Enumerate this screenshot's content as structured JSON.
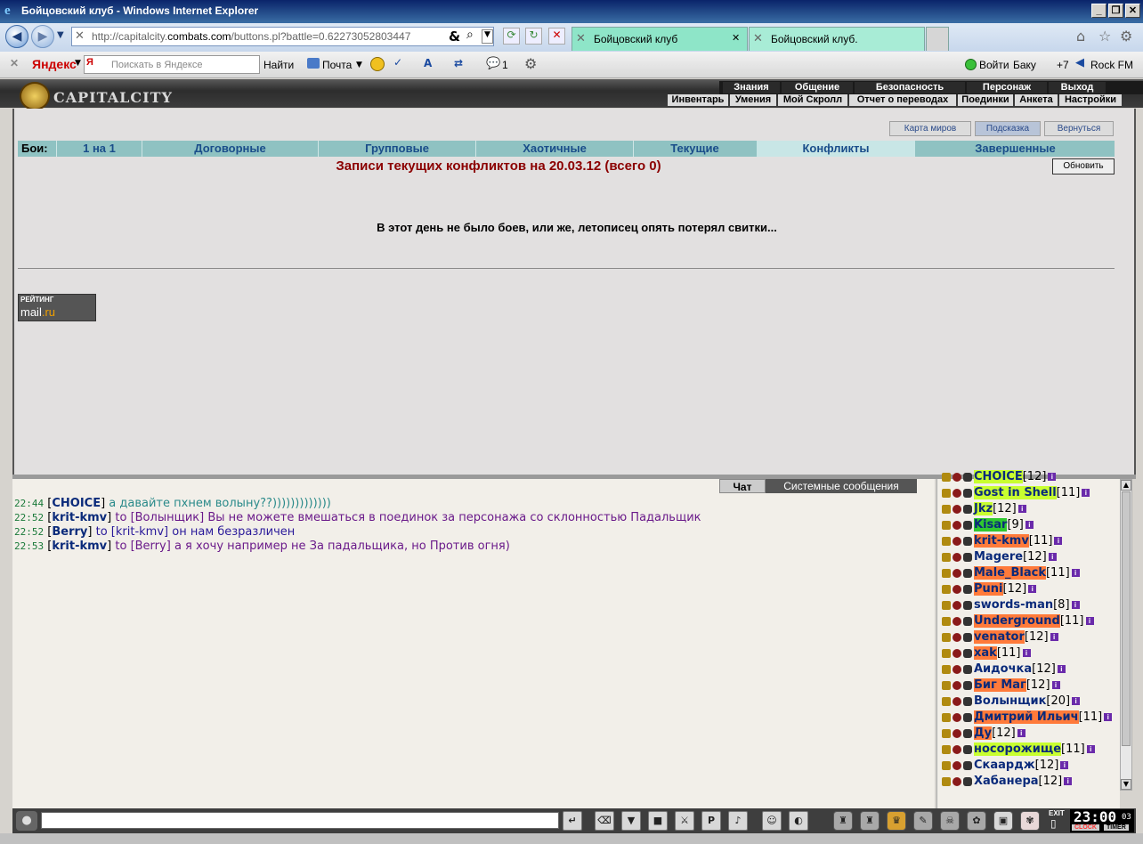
{
  "window": {
    "title": "Бойцовский клуб - Windows Internet Explorer",
    "min": "_",
    "max": "❐",
    "close": "✕"
  },
  "address": {
    "url_prefix": "http://capitalcity.",
    "url_domain": "combats.com",
    "url_suffix": "/buttons.pl?battle=0.62273052803447"
  },
  "tabs": [
    {
      "label": "Бойцовский клуб"
    },
    {
      "label": "Бойцовский клуб."
    }
  ],
  "yandex": {
    "brand": "Яндекс",
    "placeholder": "Поискать в Яндексе",
    "find": "Найти",
    "mail": "Почта",
    "msg_count": "1",
    "login": "Войти",
    "baku": "Баку",
    "temp": "+7",
    "radio": "Rock FM"
  },
  "game_menu": {
    "top": [
      "Знания",
      "Общение",
      "Безопасность",
      "Персонаж",
      "Выход"
    ],
    "bottom": [
      "Инвентарь",
      "Умения",
      "Мой Скролл",
      "Отчет о переводах",
      "Поединки",
      "Анкета",
      "Настройки"
    ],
    "logo": "CAPITALCITY"
  },
  "side_buttons": [
    "Карта миров",
    "Подсказка",
    "Вернуться"
  ],
  "battle_tabs": {
    "label": "Бои:",
    "items": [
      "1 на 1",
      "Договорные",
      "Групповые",
      "Хаотичные",
      "Текущие",
      "Конфликты",
      "Завершенные"
    ]
  },
  "heading": "Записи текущих конфликтов на 20.03.12 (всего 0)",
  "refresh": "Обновить",
  "no_battles": "В этот день не было боев, или же, летописец опять потерял свитки...",
  "rating": {
    "top": "РЕЙТИНГ",
    "mail": "mail",
    "ru": ".ru"
  },
  "chat_tabs": [
    "Чат",
    "Системные сообщения"
  ],
  "chat": [
    {
      "time": "22:44",
      "from": "CHOICE",
      "to": "",
      "text": "а давайте пхнем волыну??)))))))))))))",
      "color": "#2a8a8a"
    },
    {
      "time": "22:52",
      "from": "krit-kmv",
      "to": "Волынщик",
      "text": "Вы не можете вмешаться в поединок за персонажа со склонностью Падальщик",
      "color": "#6a1a8a"
    },
    {
      "time": "22:52",
      "from": "Berry",
      "to": "krit-kmv",
      "text": "он нам безразличен",
      "color": "#2a1a9a"
    },
    {
      "time": "22:53",
      "from": "krit-kmv",
      "to": "Berry",
      "text": "а я хочу например не За падальщика, но Против огня)",
      "color": "#6a1a8a"
    }
  ],
  "chat_to": "to",
  "users": [
    {
      "name": "CHOICE",
      "level": "[12]",
      "bg": "#c8ff30"
    },
    {
      "name": "Gost in Shell",
      "level": "[11]",
      "bg": "#c8ff30"
    },
    {
      "name": "Jkz",
      "level": "[12]",
      "bg": "#c8ff30"
    },
    {
      "name": "Kisar",
      "level": "[9]",
      "bg": "#30c830"
    },
    {
      "name": "krit-kmv",
      "level": "[11]",
      "bg": "#ff7a3a"
    },
    {
      "name": "Magere",
      "level": "[12]",
      "bg": ""
    },
    {
      "name": "Male_Black",
      "level": "[11]",
      "bg": "#ff7a3a"
    },
    {
      "name": "Puni",
      "level": "[12]",
      "bg": "#ff7a3a"
    },
    {
      "name": "swords-man",
      "level": "[8]",
      "bg": ""
    },
    {
      "name": "Underground",
      "level": "[11]",
      "bg": "#ff7a3a"
    },
    {
      "name": "venator",
      "level": "[12]",
      "bg": "#ff7a3a"
    },
    {
      "name": "xak",
      "level": "[11]",
      "bg": "#ff7a3a"
    },
    {
      "name": "Аидочка",
      "level": "[12]",
      "bg": ""
    },
    {
      "name": "Биг Маг",
      "level": "[12]",
      "bg": "#ff7a3a"
    },
    {
      "name": "Волынщик",
      "level": "[20]",
      "bg": ""
    },
    {
      "name": "Дмитрий Ильич",
      "level": "[11]",
      "bg": "#ff7a3a"
    },
    {
      "name": "Ду",
      "level": "[12]",
      "bg": "#ff7a3a"
    },
    {
      "name": "носорожище",
      "level": "[11]",
      "bg": "#c8ff30"
    },
    {
      "name": "Скаардж",
      "level": "[12]",
      "bg": ""
    },
    {
      "name": "Хабанера",
      "level": "[12]",
      "bg": ""
    }
  ],
  "clock": {
    "time": "23:00",
    "seconds": "03",
    "clock_label": "CLOCK",
    "timer_label": "TIMER",
    "exit": "EXIT"
  }
}
